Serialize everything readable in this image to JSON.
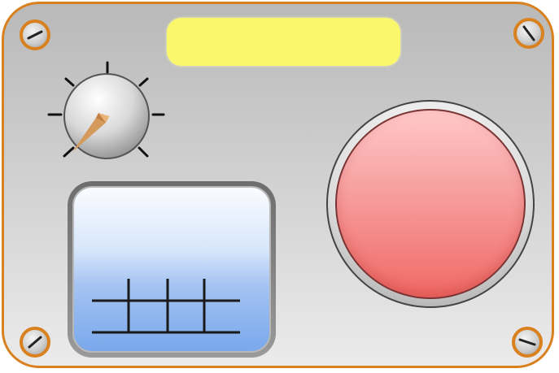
{
  "panel": {
    "label_strip_text": "",
    "colors": {
      "frame_border": "#d9801f",
      "label_strip": "#fbf76c",
      "button_red": "#f06a66",
      "screen_blue": "#7aa8ec",
      "knob_pointer": "#d39a5c"
    }
  },
  "icons": {
    "screws": [
      "screw-icon",
      "screw-icon",
      "screw-icon",
      "screw-icon"
    ],
    "knob": "rotary-knob-icon",
    "pointer": "compass-pointer-icon",
    "screen_pattern": "grid-graph-icon",
    "big_button": "round-push-button"
  }
}
